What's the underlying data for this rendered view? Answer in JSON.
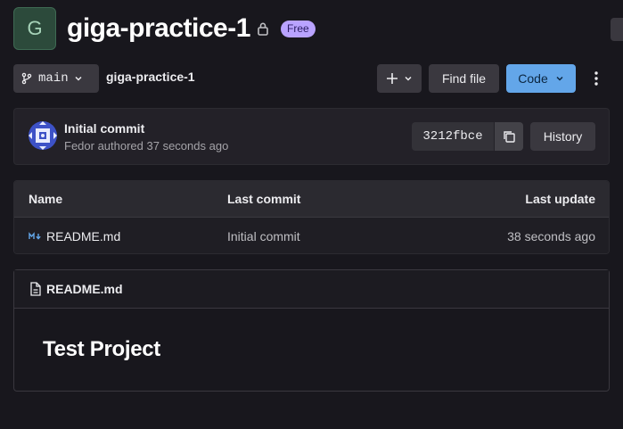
{
  "project": {
    "avatar_letter": "G",
    "name": "giga-practice-1",
    "visibility_icon": "lock-icon",
    "plan_badge": "Free"
  },
  "toolbar": {
    "branch_icon": "branch-icon",
    "branch": "main",
    "breadcrumb": "giga-practice-1",
    "add_icon": "plus-icon",
    "find_file": "Find file",
    "code": "Code",
    "more_icon": "kebab-icon"
  },
  "last_commit": {
    "title": "Initial commit",
    "author_line": "Fedor authored 37 seconds ago",
    "sha": "3212fbce",
    "copy_icon": "copy-icon",
    "history": "History"
  },
  "files_table": {
    "columns": [
      "Name",
      "Last commit",
      "Last update"
    ],
    "rows": [
      {
        "icon": "markdown-icon",
        "name": "README.md",
        "last_commit": "Initial commit",
        "last_update": "38 seconds ago"
      }
    ]
  },
  "readme": {
    "file_icon": "file-icon",
    "filename": "README.md",
    "heading": "Test Project"
  },
  "colors": {
    "background": "#18171d",
    "primary_button": "#63a6e9",
    "badge": "#b9a3ff"
  }
}
